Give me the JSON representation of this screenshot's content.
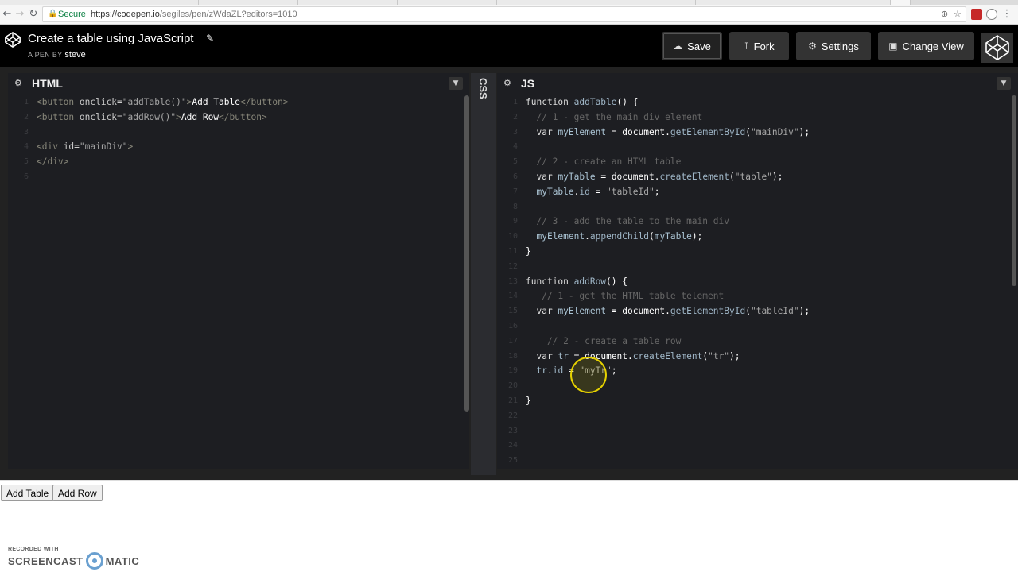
{
  "browser": {
    "security_label": "Secure",
    "url_host": "https://codepen.io",
    "url_path": "/segiles/pen/zWdaZL?editors=1010",
    "colors": {
      "secure": "#0b8043"
    }
  },
  "header": {
    "title": "Create a table using JavaScript",
    "byline_prefix": "A PEN BY",
    "author": "steve",
    "buttons": {
      "save": "Save",
      "fork": "Fork",
      "settings": "Settings",
      "change_view": "Change View"
    }
  },
  "html_panel": {
    "title": "HTML",
    "line_numbers": [
      "1",
      "2",
      "3",
      "4",
      "5",
      "6"
    ]
  },
  "css_panel": {
    "title": "CSS"
  },
  "js_panel": {
    "title": "JS",
    "line_numbers": [
      "1",
      "2",
      "3",
      "4",
      "5",
      "6",
      "7",
      "8",
      "9",
      "10",
      "11",
      "12",
      "13",
      "14",
      "15",
      "16",
      "17",
      "18",
      "19",
      "20",
      "21",
      "22",
      "23",
      "24",
      "25"
    ]
  },
  "html_code": {
    "l1": {
      "open": "<button",
      "attr": " onclick=",
      "val": "\"addTable()\"",
      "close": ">",
      "text": "Add Table",
      "end": "</button>"
    },
    "l2": {
      "open": "<button",
      "attr": " onclick=",
      "val": "\"addRow()\"",
      "close": ">",
      "text": "Add Row",
      "end": "</button>"
    },
    "l4": {
      "open": "<div",
      "attr": " id=",
      "val": "\"mainDiv\"",
      "close": ">"
    },
    "l5": {
      "end": "</div>"
    }
  },
  "js_code": {
    "l1": {
      "kw": "function",
      "name": " addTable",
      "rest": "() {"
    },
    "l2": {
      "comment": "  // 1 - get the main div element"
    },
    "l3": {
      "indent": "  ",
      "kw": "var",
      "var": " myElement",
      "eq": " = ",
      "obj": "document",
      "dot": ".",
      "fn": "getElementById",
      "open": "(",
      "str": "\"mainDiv\"",
      "close": ");"
    },
    "l5": {
      "comment": "  // 2 - create an HTML table"
    },
    "l6": {
      "indent": "  ",
      "kw": "var",
      "var": " myTable",
      "eq": " = ",
      "obj": "document",
      "dot": ".",
      "fn": "createElement",
      "open": "(",
      "str": "\"table\"",
      "close": ");"
    },
    "l7": {
      "indent": "  ",
      "var": "myTable",
      "dot": ".",
      "prop": "id",
      "eq": " = ",
      "str": "\"tableId\"",
      "close": ";"
    },
    "l9": {
      "comment": "  // 3 - add the table to the main div"
    },
    "l10": {
      "indent": "  ",
      "var": "myElement",
      "dot": ".",
      "fn": "appendChild",
      "open": "(",
      "arg": "myTable",
      "close": ");"
    },
    "l11": {
      "text": "}"
    },
    "l13": {
      "kw": "function",
      "name": " addRow",
      "rest": "() {"
    },
    "l14": {
      "comment": "   // 1 - get the HTML table telement"
    },
    "l15": {
      "indent": "  ",
      "kw": "var",
      "var": " myElement",
      "eq": " = ",
      "obj": "document",
      "dot": ".",
      "fn": "getElementById",
      "open": "(",
      "str": "\"tableId\"",
      "close": ");"
    },
    "l17": {
      "comment": "    // 2 - create a table row"
    },
    "l18": {
      "indent": "  ",
      "kw": "var",
      "var": " tr",
      "eq": " = ",
      "obj": "document",
      "dot": ".",
      "fn": "createElement",
      "open": "(",
      "str": "\"tr\"",
      "close": ");"
    },
    "l19": {
      "indent": "  ",
      "var": "tr",
      "dot": ".",
      "prop": "id",
      "eq": " = ",
      "str": "\"myTr\"",
      "close": ";"
    },
    "l21": {
      "text": "}"
    }
  },
  "result": {
    "add_table_label": "Add Table",
    "add_row_label": "Add Row"
  },
  "watermark": {
    "small": "RECORDED WITH",
    "left": "SCREENCAST",
    "right": "MATIC"
  }
}
